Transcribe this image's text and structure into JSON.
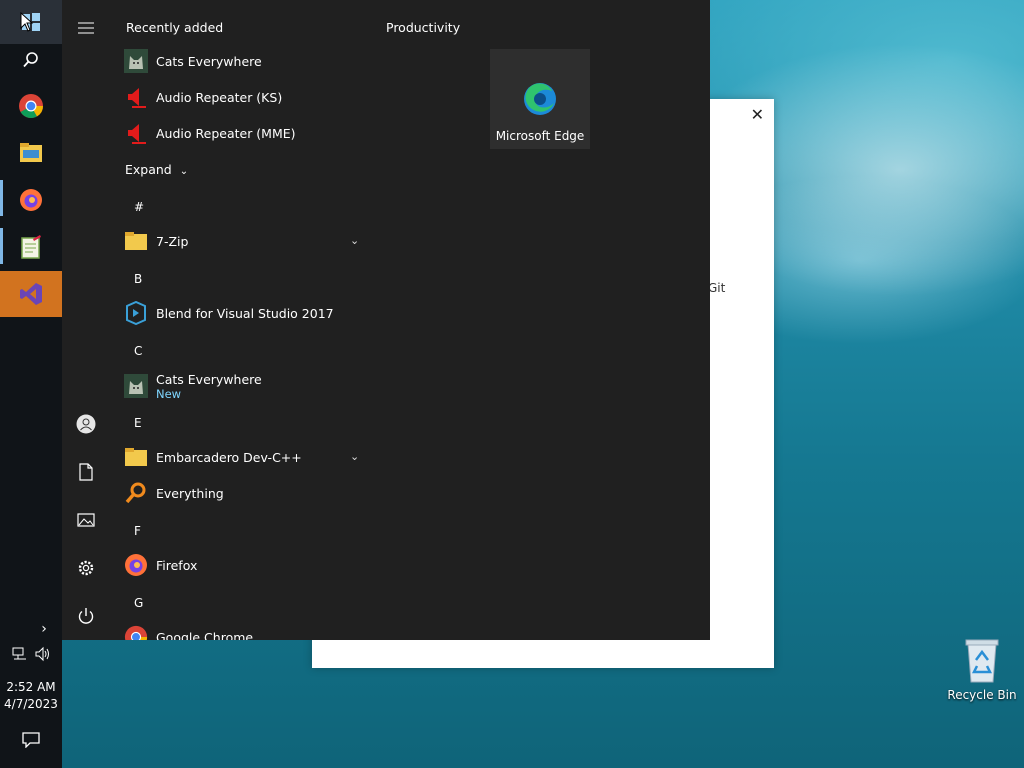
{
  "taskbar": {
    "clock_time": "2:52 AM",
    "clock_date": "4/7/2023",
    "apps": [
      {
        "name": "start-button",
        "icon": "windows-logo"
      },
      {
        "name": "search",
        "icon": "search-icon"
      },
      {
        "name": "chrome",
        "icon": "chrome-icon"
      },
      {
        "name": "file-explorer",
        "icon": "folder-icon"
      },
      {
        "name": "firefox",
        "icon": "firefox-icon"
      },
      {
        "name": "notepad",
        "icon": "notepad-icon"
      },
      {
        "name": "visual-studio",
        "icon": "visual-studio-icon"
      }
    ]
  },
  "start_menu": {
    "recently_added_title": "Recently added",
    "recent": [
      {
        "label": "Cats Everywhere"
      },
      {
        "label": "Audio Repeater (KS)"
      },
      {
        "label": "Audio Repeater (MME)"
      }
    ],
    "expand_label": "Expand",
    "groups": {
      "hash": "#",
      "b": "B",
      "c": "C",
      "e": "E",
      "f": "F",
      "g": "G"
    },
    "apps": {
      "seven_zip": "7-Zip",
      "blend": "Blend for Visual Studio 2017",
      "cats": "Cats Everywhere",
      "cats_badge": "New",
      "embarcadero": "Embarcadero Dev-C++",
      "everything": "Everything",
      "firefox": "Firefox",
      "chrome": "Google Chrome"
    },
    "tiles_group_title": "Productivity",
    "tile_edge": "Microsoft Edge"
  },
  "background_window": {
    "close_glyph": "✕",
    "partial_text": "Git"
  },
  "desktop": {
    "recycle_bin": "Recycle Bin"
  },
  "colors": {
    "start_bg": "#202020",
    "taskbar_bg": "#101418",
    "accent_new": "#7fd6ff",
    "vs_highlight": "#d2731f"
  }
}
